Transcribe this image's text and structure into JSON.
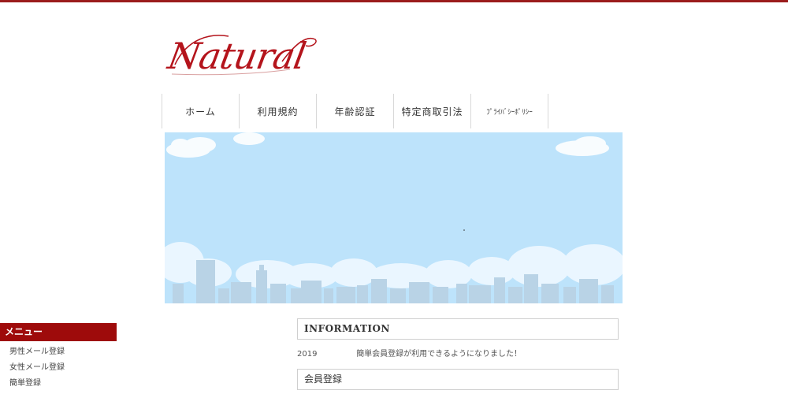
{
  "site": {
    "logo_text": "Natural"
  },
  "nav": {
    "items": [
      {
        "label": "ホーム"
      },
      {
        "label": "利用規約"
      },
      {
        "label": "年齢認証"
      },
      {
        "label": "特定商取引法"
      },
      {
        "label": "ﾌﾟﾗｲﾊﾞｼｰﾎﾟﾘｼｰ"
      }
    ]
  },
  "sidebar": {
    "title": "メニュー",
    "items": [
      {
        "label": "男性メール登録"
      },
      {
        "label": "女性メール登録"
      },
      {
        "label": "簡単登録"
      }
    ]
  },
  "main": {
    "info_title": "INFORMATION",
    "news": [
      {
        "date": "2019",
        "text": "簡単会員登録が利用できるようになりました！"
      }
    ],
    "member_title": "会員登録"
  },
  "colors": {
    "accent": "#9e0b0b",
    "logo": "#b4141c",
    "sky": "#bde3fb",
    "buildings": "#b9d3e6"
  }
}
